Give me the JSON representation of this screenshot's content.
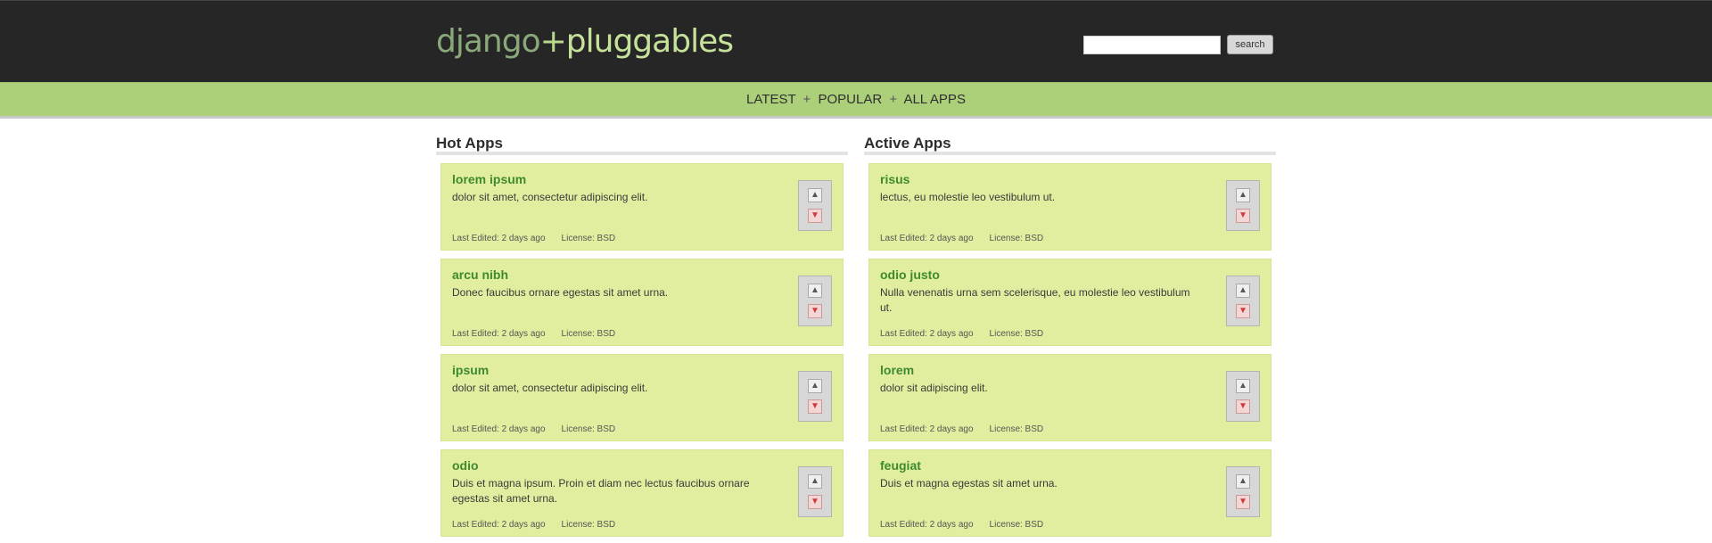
{
  "header": {
    "logo": {
      "part1": "django",
      "part2": "+",
      "part3": "pluggables"
    },
    "search": {
      "placeholder": "",
      "value": "",
      "button_label": "search"
    }
  },
  "nav": {
    "items": [
      {
        "label": "LATEST"
      },
      {
        "label": "POPULAR"
      },
      {
        "label": "ALL APPS"
      }
    ],
    "separator": "+"
  },
  "hot_apps": {
    "title": "Hot Apps",
    "cards": [
      {
        "title": "lorem ipsum",
        "desc": "dolor sit amet, consectetur adipiscing elit.",
        "last_edited": "Last Edited: 2 days ago",
        "license": "License: BSD"
      },
      {
        "title": "arcu nibh",
        "desc": "Donec faucibus ornare egestas sit amet urna.",
        "last_edited": "Last Edited: 2 days ago",
        "license": "License: BSD"
      },
      {
        "title": "ipsum",
        "desc": "dolor sit amet, consectetur adipiscing elit.",
        "last_edited": "Last Edited: 2 days ago",
        "license": "License: BSD"
      },
      {
        "title": "odio",
        "desc": "Duis et magna ipsum. Proin et diam nec lectus faucibus ornare egestas sit amet urna.",
        "last_edited": "Last Edited: 2 days ago",
        "license": "License: BSD"
      }
    ]
  },
  "active_apps": {
    "title": "Active Apps",
    "cards": [
      {
        "title": "risus",
        "desc": "lectus, eu molestie leo vestibulum ut.",
        "last_edited": "Last Edited: 2 days ago",
        "license": "License: BSD"
      },
      {
        "title": "odio justo",
        "desc": "Nulla venenatis urna sem scelerisque, eu molestie leo vestibulum ut.",
        "last_edited": "Last Edited: 2 days ago",
        "license": "License: BSD"
      },
      {
        "title": "lorem",
        "desc": "dolor sit adipiscing elit.",
        "last_edited": "Last Edited: 2 days ago",
        "license": "License: BSD"
      },
      {
        "title": "feugiat",
        "desc": "Duis et magna egestas sit amet urna.",
        "last_edited": "Last Edited: 2 days ago",
        "license": "License: BSD"
      }
    ]
  },
  "vote": {
    "up_symbol": "▲",
    "down_symbol": "▼"
  },
  "colors": {
    "header_bg": "#262626",
    "nav_bg": "#acd07a",
    "card_bg": "#e2ee9f",
    "card_title": "#3d8a2f"
  }
}
